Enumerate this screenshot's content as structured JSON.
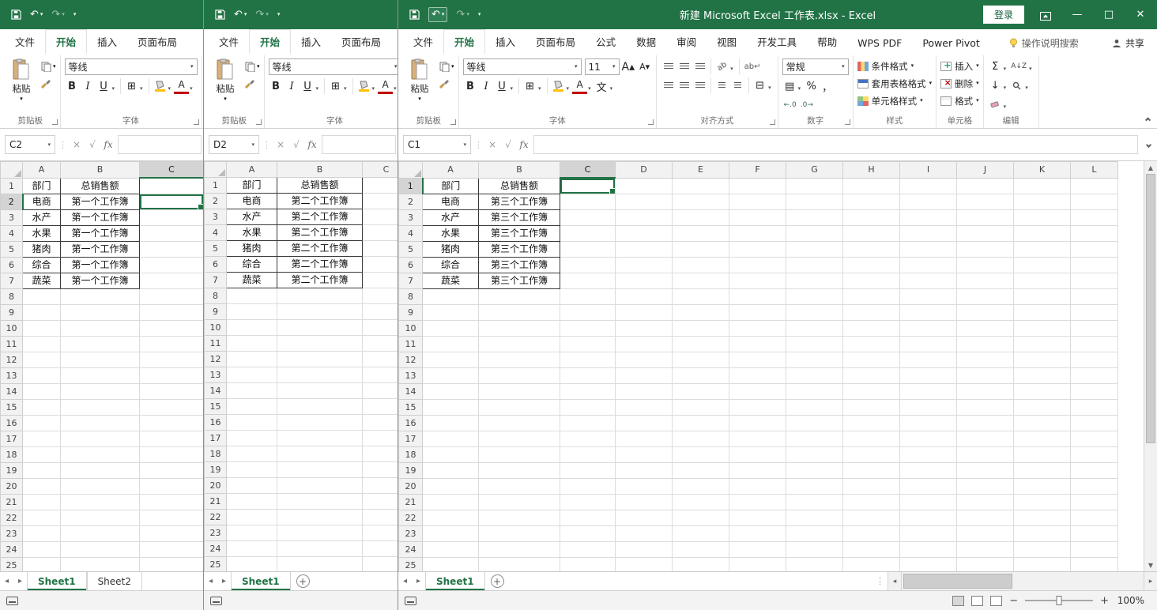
{
  "app": {
    "title": "新建 Microsoft Excel 工作表.xlsx - Excel",
    "login": "登录",
    "share": "共享",
    "search_hint": "操作说明搜索"
  },
  "ribbon": {
    "tabs_full": [
      "文件",
      "开始",
      "插入",
      "页面布局",
      "公式",
      "数据",
      "审阅",
      "视图",
      "开发工具",
      "帮助",
      "WPS PDF",
      "Power Pivot"
    ],
    "tabs_small": [
      "文件",
      "开始",
      "插入",
      "页面布局"
    ],
    "active_tab": "开始",
    "paste": "粘贴",
    "font_name": "等线",
    "font_size": "11",
    "number_format": "常规",
    "bold": "B",
    "italic": "I",
    "underline": "U",
    "autosum": "Σ",
    "percent": "%",
    "comma": "，",
    "increase_decimal": "←.0",
    "decrease_decimal": ".0→",
    "group_labels": {
      "clipboard": "剪贴板",
      "font": "字体",
      "alignment": "对齐方式",
      "number": "数字",
      "styles": "样式",
      "cells": "单元格",
      "editing": "编辑"
    },
    "styles_buttons": [
      "条件格式",
      "套用表格格式",
      "单元格样式"
    ],
    "cells_buttons": [
      "插入",
      "删除",
      "格式"
    ]
  },
  "formula": {
    "fx_label": "fx"
  },
  "windows": [
    {
      "name_box": "C2",
      "columns": [
        "A",
        "B",
        "C"
      ],
      "row_count": 25,
      "selection": {
        "column": "C",
        "row": 2
      },
      "sheet_tabs": [
        "Sheet1",
        "Sheet2"
      ],
      "active_sheet": "Sheet1",
      "show_add_sheet": false,
      "table": {
        "headers": [
          "部门",
          "总销售额"
        ],
        "departments": [
          "电商",
          "水产",
          "水果",
          "猪肉",
          "综合",
          "蔬菜"
        ],
        "values": [
          "第一个工作簿",
          "第一个工作簿",
          "第一个工作簿",
          "第一个工作簿",
          "第一个工作簿",
          "第一个工作簿"
        ]
      }
    },
    {
      "name_box": "D2",
      "columns": [
        "A",
        "B",
        "C"
      ],
      "row_count": 25,
      "selection": null,
      "sheet_tabs": [
        "Sheet1"
      ],
      "active_sheet": "Sheet1",
      "show_add_sheet": true,
      "table": {
        "headers": [
          "部门",
          "总销售额"
        ],
        "departments": [
          "电商",
          "水产",
          "水果",
          "猪肉",
          "综合",
          "蔬菜"
        ],
        "values": [
          "第二个工作簿",
          "第二个工作簿",
          "第二个工作簿",
          "第二个工作簿",
          "第二个工作簿",
          "第二个工作簿"
        ]
      }
    },
    {
      "name_box": "C1",
      "columns": [
        "A",
        "B",
        "C",
        "D",
        "E",
        "F",
        "G",
        "H",
        "I",
        "J",
        "K",
        "L"
      ],
      "row_count": 25,
      "selection": {
        "column": "C",
        "row": 1
      },
      "sheet_tabs": [
        "Sheet1"
      ],
      "active_sheet": "Sheet1",
      "show_add_sheet": true,
      "table": {
        "headers": [
          "部门",
          "总销售额"
        ],
        "departments": [
          "电商",
          "水产",
          "水果",
          "猪肉",
          "综合",
          "蔬菜"
        ],
        "values": [
          "第三个工作簿",
          "第三个工作簿",
          "第三个工作簿",
          "第三个工作簿",
          "第三个工作簿",
          "第三个工作簿"
        ]
      }
    }
  ],
  "status": {
    "zoom": "100%"
  }
}
